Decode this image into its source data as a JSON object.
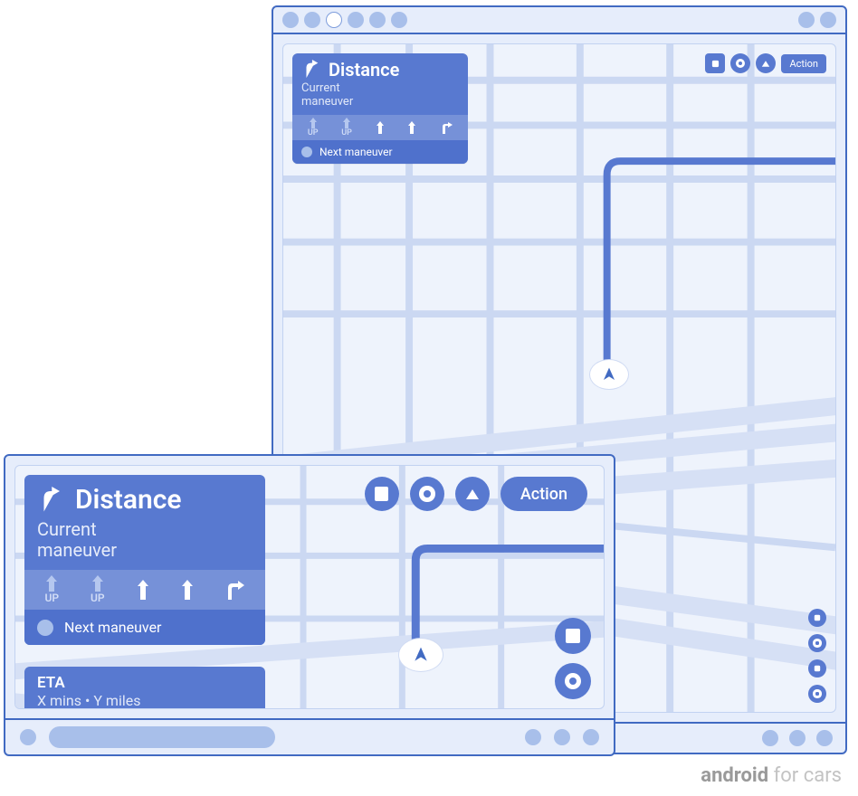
{
  "nav": {
    "distance_label": "Distance",
    "current_maneuver": "Current\nmaneuver",
    "next_maneuver": "Next maneuver",
    "lanes": [
      {
        "dir": "up",
        "label": "UP"
      },
      {
        "dir": "up",
        "label": "UP"
      },
      {
        "dir": "up",
        "label": ""
      },
      {
        "dir": "up",
        "label": ""
      },
      {
        "dir": "right",
        "label": ""
      }
    ]
  },
  "eta": {
    "title": "ETA",
    "subtitle": "X mins • Y miles"
  },
  "action_button_label": "Action",
  "brand": {
    "bold": "android",
    "rest": " for cars"
  }
}
